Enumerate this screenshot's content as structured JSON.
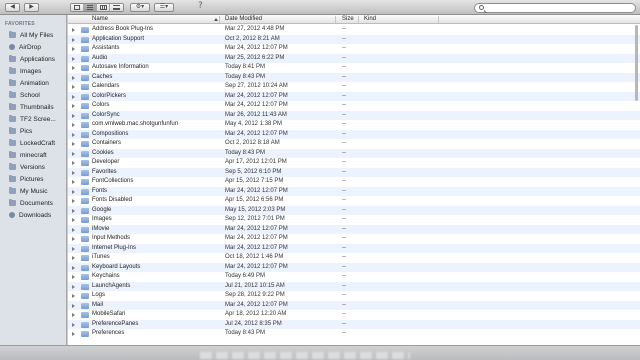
{
  "toolbar": {
    "back_icon": "chevron-left-icon",
    "forward_icon": "chevron-right-icon",
    "views": [
      "icon-view",
      "list-view",
      "column-view",
      "cover-flow-view"
    ],
    "active_view": "list-view",
    "action_icon": "gear-icon",
    "arrange_icon": "arrange-icon",
    "help_glyph": "?",
    "search": {
      "placeholder": ""
    }
  },
  "sidebar": {
    "heading": "FAVORITES",
    "items": [
      {
        "label": "All My Files",
        "icon": "all-files-icon"
      },
      {
        "label": "AirDrop",
        "icon": "airdrop-icon"
      },
      {
        "label": "Applications",
        "icon": "applications-icon"
      },
      {
        "label": "Images",
        "icon": "folder-icon"
      },
      {
        "label": "Animation",
        "icon": "folder-icon"
      },
      {
        "label": "School",
        "icon": "folder-icon"
      },
      {
        "label": "Thumbnails",
        "icon": "folder-icon"
      },
      {
        "label": "TF2 Scree...",
        "icon": "folder-icon"
      },
      {
        "label": "Pics",
        "icon": "folder-icon"
      },
      {
        "label": "LockedCraft",
        "icon": "folder-icon"
      },
      {
        "label": "minecraft",
        "icon": "folder-icon"
      },
      {
        "label": "Versions",
        "icon": "folder-icon"
      },
      {
        "label": "Pictures",
        "icon": "pictures-icon"
      },
      {
        "label": "My Music",
        "icon": "music-icon"
      },
      {
        "label": "Documents",
        "icon": "documents-icon"
      },
      {
        "label": "Downloads",
        "icon": "downloads-icon"
      }
    ]
  },
  "columns": {
    "name": "Name",
    "date": "Date Modified",
    "size": "Size",
    "kind": "Kind"
  },
  "rows": [
    {
      "name": "Address Book Plug-Ins",
      "date": "Mar 27, 2012 4:48 PM",
      "size": "--"
    },
    {
      "name": "Application Support",
      "date": "Oct 2, 2012 8:21 AM",
      "size": "--"
    },
    {
      "name": "Assistants",
      "date": "Mar 24, 2012 12:07 PM",
      "size": "--"
    },
    {
      "name": "Audio",
      "date": "Mar 25, 2012 6:22 PM",
      "size": "--"
    },
    {
      "name": "Autosave Information",
      "date": "Today 8:41 PM",
      "size": "--"
    },
    {
      "name": "Caches",
      "date": "Today 8:43 PM",
      "size": "--"
    },
    {
      "name": "Calendars",
      "date": "Sep 27, 2012 10:24 AM",
      "size": "--"
    },
    {
      "name": "ColorPickers",
      "date": "Mar 24, 2012 12:07 PM",
      "size": "--"
    },
    {
      "name": "Colors",
      "date": "Mar 24, 2012 12:07 PM",
      "size": "--"
    },
    {
      "name": "ColorSync",
      "date": "Mar 26, 2012 11:43 AM",
      "size": "--"
    },
    {
      "name": "com.vmlweb.mac.shotgunfunfun",
      "date": "May 4, 2012 1:38 PM",
      "size": "--"
    },
    {
      "name": "Compositions",
      "date": "Mar 24, 2012 12:07 PM",
      "size": "--"
    },
    {
      "name": "Containers",
      "date": "Oct 2, 2012 8:18 AM",
      "size": "--"
    },
    {
      "name": "Cookies",
      "date": "Today 8:43 PM",
      "size": "--"
    },
    {
      "name": "Developer",
      "date": "Apr 17, 2012 12:01 PM",
      "size": "--"
    },
    {
      "name": "Favorites",
      "date": "Sep 5, 2012 6:10 PM",
      "size": "--"
    },
    {
      "name": "FontCollections",
      "date": "Apr 15, 2012 7:15 PM",
      "size": "--"
    },
    {
      "name": "Fonts",
      "date": "Mar 24, 2012 12:07 PM",
      "size": "--"
    },
    {
      "name": "Fonts Disabled",
      "date": "Apr 15, 2012 6:56 PM",
      "size": "--"
    },
    {
      "name": "Google",
      "date": "May 15, 2012 2:03 PM",
      "size": "--"
    },
    {
      "name": "Images",
      "date": "Sep 12, 2012 7:01 PM",
      "size": "--"
    },
    {
      "name": "iMovie",
      "date": "Mar 24, 2012 12:07 PM",
      "size": "--"
    },
    {
      "name": "Input Methods",
      "date": "Mar 24, 2012 12:07 PM",
      "size": "--"
    },
    {
      "name": "Internet Plug-Ins",
      "date": "Mar 24, 2012 12:07 PM",
      "size": "--"
    },
    {
      "name": "iTunes",
      "date": "Oct 18, 2012 1:46 PM",
      "size": "--"
    },
    {
      "name": "Keyboard Layouts",
      "date": "Mar 24, 2012 12:07 PM",
      "size": "--"
    },
    {
      "name": "Keychains",
      "date": "Today 6:49 PM",
      "size": "--"
    },
    {
      "name": "LaunchAgents",
      "date": "Jul 21, 2012 10:15 AM",
      "size": "--"
    },
    {
      "name": "Logs",
      "date": "Sep 28, 2012 9:22 PM",
      "size": "--"
    },
    {
      "name": "Mail",
      "date": "Mar 24, 2012 12:07 PM",
      "size": "--"
    },
    {
      "name": "MobileSafari",
      "date": "Apr 18, 2012 12:20 AM",
      "size": "--"
    },
    {
      "name": "PreferencePanes",
      "date": "Jul 24, 2012 8:35 PM",
      "size": "--"
    },
    {
      "name": "Preferences",
      "date": "Today 8:43 PM",
      "size": "--"
    }
  ]
}
